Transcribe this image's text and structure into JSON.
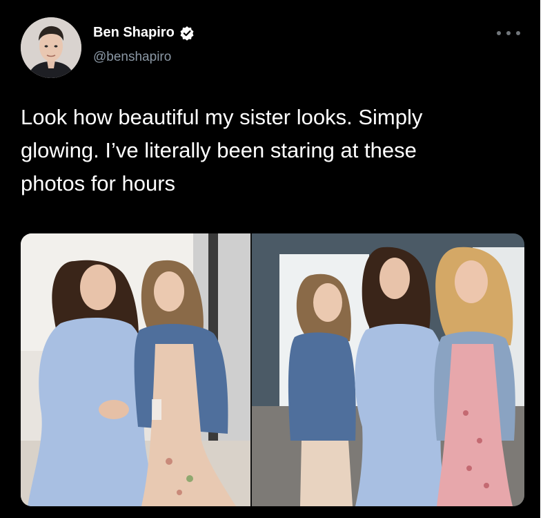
{
  "author": {
    "display_name": "Ben Shapiro",
    "handle": "@benshapiro",
    "verified": true,
    "avatar_icon": "profile-photo",
    "verified_icon": "verified-badge-icon"
  },
  "tweet": {
    "text": "Look how beautiful my sister looks. Simply\nglowing. I’ve literally been staring at these\nphotos for hours"
  },
  "media": {
    "count": 2,
    "photo_1": "photo-two-women-blue-dress",
    "photo_2": "photo-three-women-standing"
  },
  "icons": {
    "more": "more-options-icon"
  },
  "colors": {
    "background": "#000000",
    "text": "#ffffff",
    "secondary_text": "#8b98a5",
    "verified": "#1d9bf0"
  }
}
